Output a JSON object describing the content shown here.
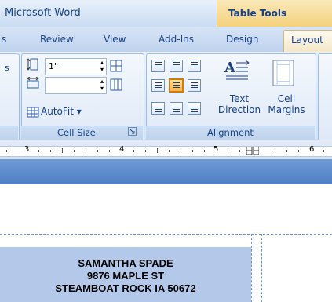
{
  "window": {
    "title": "Microsoft Word",
    "contextual_tab_group": "Table Tools"
  },
  "tabs": [
    {
      "label": "s"
    },
    {
      "label": "Review"
    },
    {
      "label": "View"
    },
    {
      "label": "Add-Ins"
    },
    {
      "label": "Design"
    },
    {
      "label": "Layout",
      "selected": true
    }
  ],
  "ribbon": {
    "left_group_fragment": "s",
    "cell_size": {
      "label": "Cell Size",
      "height_value": "1\"",
      "width_value": "",
      "autofit_label": "AutoFit ▾",
      "launcher_icon": "dialog-launcher-icon"
    },
    "alignment": {
      "label": "Alignment",
      "selected_button": "align-center-center",
      "text_direction_label": "Text Direction",
      "text_direction_line1": "Text",
      "text_direction_line2": "Direction",
      "cell_margins_line1": "Cell",
      "cell_margins_line2": "Margins"
    }
  },
  "ruler": {
    "numbers": [
      "3",
      "4",
      "5",
      "6"
    ]
  },
  "document": {
    "label_lines": [
      "SAMANTHA SPADE",
      "9876 MAPLE ST",
      "STEAMBOAT ROCK IA 50672"
    ]
  },
  "colors": {
    "accent": "#15428b",
    "selected_tab": "#f3e6c6",
    "selected_button": "#f7b54a",
    "cell_shading": "#b4c9ea"
  }
}
